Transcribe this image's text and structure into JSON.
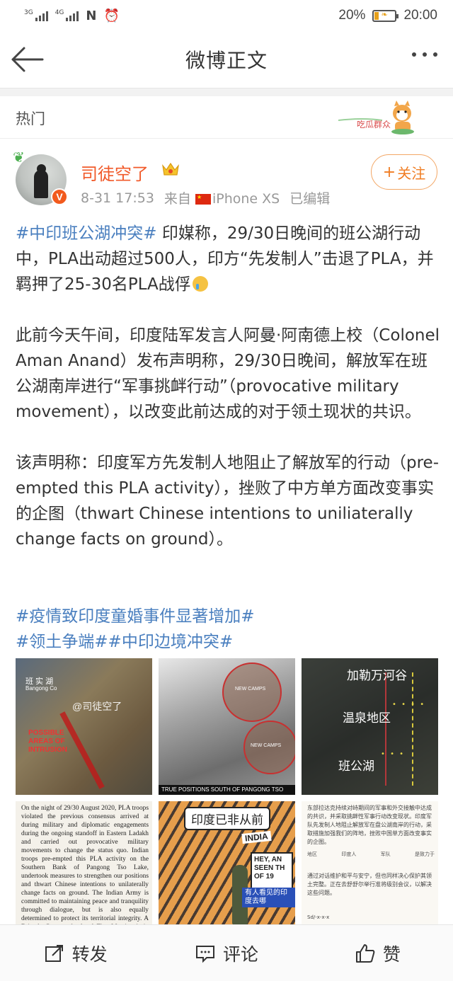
{
  "status_bar": {
    "signal1_tag": "3G",
    "signal2_tag": "4G",
    "battery_percent": "20%",
    "battery_level": 0.2,
    "time": "20:00"
  },
  "header": {
    "title": "微博正文"
  },
  "hot": {
    "label": "热门",
    "mascot_text": "吃瓜群众"
  },
  "author": {
    "name": "司徒空了",
    "date": "8-31 17:53",
    "source_prefix": "来自",
    "device": "iPhone XS",
    "edited": "已编辑",
    "verified_badge": "V",
    "follow_label": "关注"
  },
  "post": {
    "p1_tag": "#中印班公湖冲突#",
    "p1_text": " 印媒称，29/30日晚间的班公湖行动中，PLA出动超过500人，印方“先发制人”击退了PLA，并羁押了25-30名PLA战俘",
    "p2_text": "此前今天午间，印度陆军发言人阿曼·阿南德上校（Colonel Aman Anand）发布声明称，29/30日晚间，解放军在班公湖南岸进行“军事挑衅行动”（provocative military movement），以改变此前达成的对于领土现状的共识。",
    "p3_text": "该声明称：印度军方先发制人地阻止了解放军的行动（pre-empted this PLA activity），挫败了中方单方面改变事实的企图（thwart Chinese intentions to uniliaterally change facts on ground）。"
  },
  "tags": {
    "tag1": "#疫情致印度童婚事件显著增加#",
    "tag2": "#领土争端#",
    "tag3": "#中印边境冲突#"
  },
  "images": {
    "img1": {
      "label_top": "班 实 湖",
      "label_sub": "Bangong Co",
      "watermark": "@司徒空了",
      "label_red": "POSSIBLE AREAS OF INTRUSION"
    },
    "img2": {
      "new_camps_1": "NEW CAMPS",
      "new_camps_2": "NEW CAMPS",
      "caption": "TRUE POSITIONS SOUTH OF PANGONG TSO"
    },
    "img3": {
      "place1": "加勒万河谷",
      "place2": "温泉地区",
      "place3": "班公湖"
    },
    "img4": {
      "text": "On the night of 29/30 August 2020, PLA troops violated the previous consensus arrived at during military and diplomatic engagements during the ongoing standoff in Eastern Ladakh and carried out provocative military movements to change the status quo. Indian troops pre-empted this PLA activity on the Southern Bank of Pangong Tso Lake, undertook measures to strengthen our positions and thwart Chinese intentions to unilaterally change facts on ground. The Indian Army is committed to maintaining peace and tranquility through dialogue, but is also equally determined to protect its territorial integrity. A Brigade Commander level Flag Meeting is in progress at Chushul to resolve the issues."
    },
    "img5": {
      "bubble": "印度已非从前",
      "banner": "INDIA",
      "sign": "HEY, AN SEEN TH OF 19",
      "sub": "有人看见的印度去哪"
    },
    "img6": {
      "text": "东部拉达克持续对峙期间的军事和外交接触中达成的共识，并采取挑衅性军事行动改变现状。印度军队先发制人地阻止解放军在盘公湖南岸的行动，采取措施加强我们的阵地，挫败中国单方面改变事实的企图。",
      "col1": "地区",
      "col2": "印度人",
      "col3": "军队",
      "col4": "是致力于",
      "text2": "通过对话维护和平与安宁，但也同样决心保护其领土完整。正在去舒舒尔举行准将级别会议，以解决这些问题。",
      "sign": "Sd/-x-x-x"
    }
  },
  "actions": {
    "repost": "转发",
    "comment": "评论",
    "like": "赞"
  },
  "colors": {
    "accent": "#f15a2a",
    "link": "#4a7fbf",
    "follow": "#f07d23"
  }
}
